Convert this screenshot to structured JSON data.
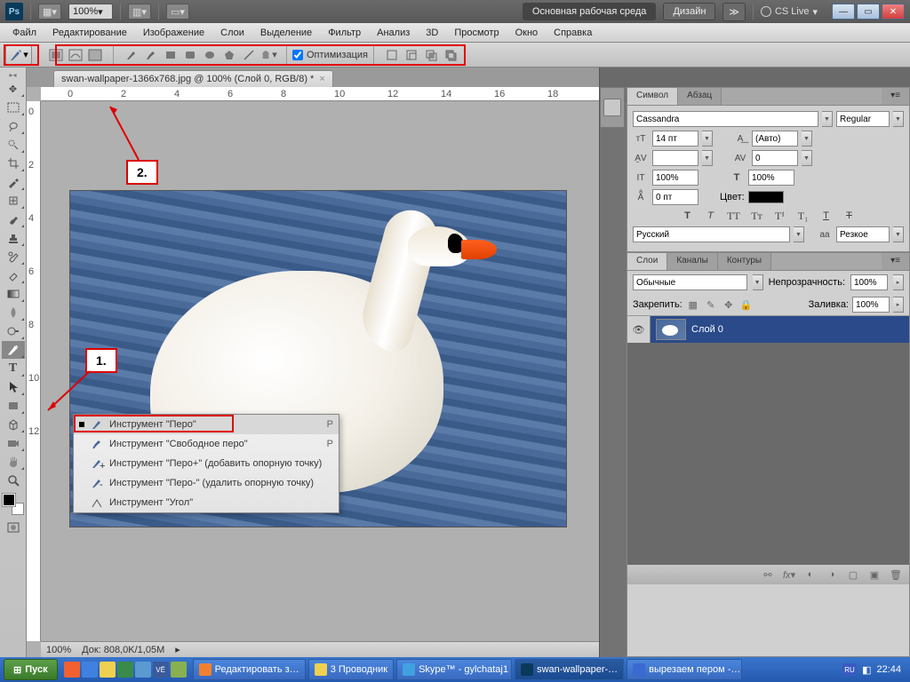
{
  "header": {
    "logo": "Ps",
    "zoom": "100%",
    "workspace_main": "Основная рабочая среда",
    "workspace_design": "Дизайн",
    "more": "≫",
    "cslive": "CS Live"
  },
  "menu": [
    "Файл",
    "Редактирование",
    "Изображение",
    "Слои",
    "Выделение",
    "Фильтр",
    "Анализ",
    "3D",
    "Просмотр",
    "Окно",
    "Справка"
  ],
  "options": {
    "optimize_label": "Оптимизация",
    "optimize_checked": true
  },
  "document": {
    "tab_title": "swan-wallpaper-1366x768.jpg @ 100% (Слой 0, RGB/8) *",
    "ruler_marks_h": [
      "0",
      "2",
      "4",
      "6",
      "8",
      "10",
      "12",
      "14",
      "16",
      "18"
    ],
    "ruler_marks_v": [
      "0",
      "2",
      "4",
      "6",
      "8",
      "10",
      "12"
    ],
    "status_zoom": "100%",
    "status_doc": "Док: 808,0K/1,05M"
  },
  "callouts": {
    "one": "1.",
    "two": "2."
  },
  "pen_flyout": [
    {
      "label": "Инструмент \"Перо\"",
      "key": "P",
      "sel": true
    },
    {
      "label": "Инструмент \"Свободное перо\"",
      "key": "P",
      "sel": false
    },
    {
      "label": "Инструмент \"Перо+\" (добавить опорную точку)",
      "key": "",
      "sel": false
    },
    {
      "label": "Инструмент \"Перо-\" (удалить опорную точку)",
      "key": "",
      "sel": false
    },
    {
      "label": "Инструмент \"Угол\"",
      "key": "",
      "sel": false
    }
  ],
  "char_panel": {
    "tab_symbol": "Символ",
    "tab_para": "Абзац",
    "font": "Cassandra",
    "style": "Regular",
    "size": "14 пт",
    "leading": "(Авто)",
    "kern": "",
    "track": "0",
    "vscale": "100%",
    "hscale": "100%",
    "baseline": "0 пт",
    "color_label": "Цвет:",
    "lang": "Русский",
    "aa_label": "aа",
    "aa": "Резкое"
  },
  "layers_panel": {
    "tabs": [
      "Слои",
      "Каналы",
      "Контуры"
    ],
    "blend": "Обычные",
    "opacity_label": "Непрозрачность:",
    "opacity": "100%",
    "lock_label": "Закрепить:",
    "fill_label": "Заливка:",
    "fill": "100%",
    "layer_name": "Слой 0"
  },
  "taskbar": {
    "start": "Пуск",
    "items": [
      {
        "label": "Редактировать з…"
      },
      {
        "label": "3 Проводник"
      },
      {
        "label": "Skype™ - gylchataj1"
      },
      {
        "label": "swan-wallpaper-…"
      },
      {
        "label": "вырезаем пером -…"
      }
    ],
    "time": "22:44",
    "lang": "RU"
  }
}
